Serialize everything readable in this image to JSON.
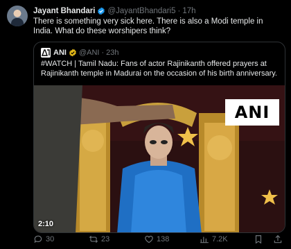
{
  "tweet": {
    "author_name": "Jayant Bhandari",
    "author_handle": "@JayantBhandari5",
    "separator": "·",
    "time": "17h",
    "text": "There is something very sick here. There is also a Modi temple in India. What do these worshipers think?"
  },
  "quoted": {
    "author_name": "ANI",
    "author_handle": "@ANI",
    "separator": "·",
    "time": "23h",
    "text": "#WATCH | Tamil Nadu: Fans of actor Rajinikanth offered prayers at Rajinikanth temple in Madurai on the occasion of his birth anniversary.",
    "video_duration": "2:10",
    "watermark": "ANI"
  },
  "actions": {
    "replies": "30",
    "reposts": "23",
    "likes": "138",
    "views": "7.2K"
  },
  "colors": {
    "background": "#000000",
    "text": "#e7e9ea",
    "muted": "#71767b",
    "border": "#2f3336",
    "verified_blue": "#1d9bf0",
    "verified_gold": "#e2b719"
  },
  "icons": [
    "verified-badge-icon",
    "gold-verified-icon",
    "reply-icon",
    "repost-icon",
    "like-icon",
    "views-icon",
    "bookmark-icon",
    "share-icon"
  ]
}
